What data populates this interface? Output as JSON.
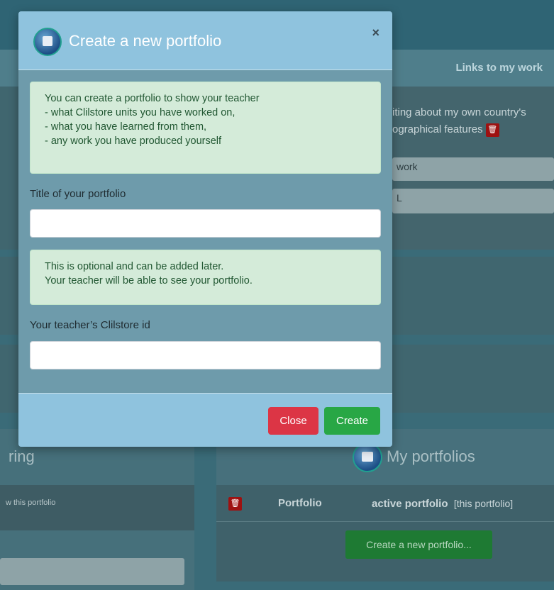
{
  "background": {
    "links_header": "Links to my work",
    "entry_text_line1": "iting about my own country's",
    "entry_text_line2": "ographical features",
    "work_field": "work",
    "second_field": "L",
    "left_card_title": "ring",
    "left_small_text": "w this portfolio",
    "my_portfolios_title": "My portfolios",
    "table": {
      "col_portfolio": "Portfolio",
      "active_label": "active portfolio",
      "this_portfolio": "[this portfolio]"
    },
    "create_new_button": "Create a new portfolio..."
  },
  "modal": {
    "title": "Create a new portfolio",
    "close_symbol": "×",
    "intro_lines": [
      "You can create a portfolio to show your teacher",
      "- what Clilstore units you have worked on,",
      "- what you have learned from them,",
      "- any work you have produced yourself"
    ],
    "title_label": "Title of your portfolio",
    "title_value": "",
    "optional_lines": [
      "This is optional and can be added later.",
      "Your teacher will be able to see your portfolio."
    ],
    "teacher_label": "Your teacher’s Clilstore id",
    "teacher_value": "",
    "close_button": "Close",
    "create_button": "Create"
  },
  "colors": {
    "modal_header": "#8fc3de",
    "modal_body": "#6e9bab",
    "alert_bg": "#d4ebd9",
    "close_button": "#dc3545",
    "create_button": "#28a745"
  }
}
